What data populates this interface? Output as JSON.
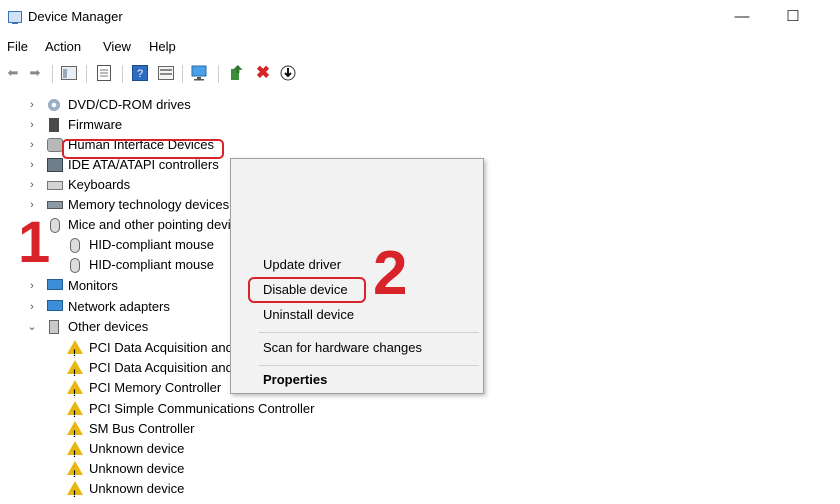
{
  "window": {
    "title": "Device Manager",
    "minimize": "—",
    "maximize": "☐"
  },
  "menu": [
    "File",
    "Action",
    "View",
    "Help"
  ],
  "tree": {
    "categories": [
      {
        "label": "DVD/CD-ROM drives",
        "state": "collapsed",
        "icon": "dvd-icon"
      },
      {
        "label": "Firmware",
        "state": "collapsed",
        "icon": "firmware-icon"
      },
      {
        "label": "Human Interface Devices",
        "state": "collapsed",
        "icon": "hid-icon"
      },
      {
        "label": "IDE ATA/ATAPI controllers",
        "state": "collapsed",
        "icon": "ide-icon"
      },
      {
        "label": "Keyboards",
        "state": "collapsed",
        "icon": "keyboard-icon"
      },
      {
        "label": "Memory technology devices",
        "state": "collapsed",
        "icon": "memory-icon"
      },
      {
        "label": "Mice and other pointing devices",
        "state": "expanded",
        "icon": "mouse-icon"
      }
    ],
    "mice_children": [
      "HID-compliant mouse",
      "HID-compliant mouse"
    ],
    "more_categories": [
      {
        "label": "Monitors",
        "state": "collapsed",
        "icon": "monitor-icon"
      },
      {
        "label": "Network adapters",
        "state": "collapsed",
        "icon": "network-icon"
      },
      {
        "label": "Other devices",
        "state": "expanded",
        "icon": "other-devices-icon"
      }
    ],
    "other_children": [
      "PCI Data Acquisition and Signal Processing Controller",
      "PCI Data Acquisition and Signal Processing Controller",
      "PCI Memory Controller",
      "PCI Simple Communications Controller",
      "SM Bus Controller",
      "Unknown device",
      "Unknown device",
      "Unknown device"
    ]
  },
  "context_menu": {
    "update": "Update driver",
    "disable": "Disable device",
    "uninstall": "Uninstall device",
    "scan": "Scan for hardware changes",
    "properties": "Properties"
  },
  "annotations": {
    "step1": "1",
    "step2": "2"
  },
  "colors": {
    "highlight": "#d8232a",
    "accent": "#3c8ed8"
  }
}
